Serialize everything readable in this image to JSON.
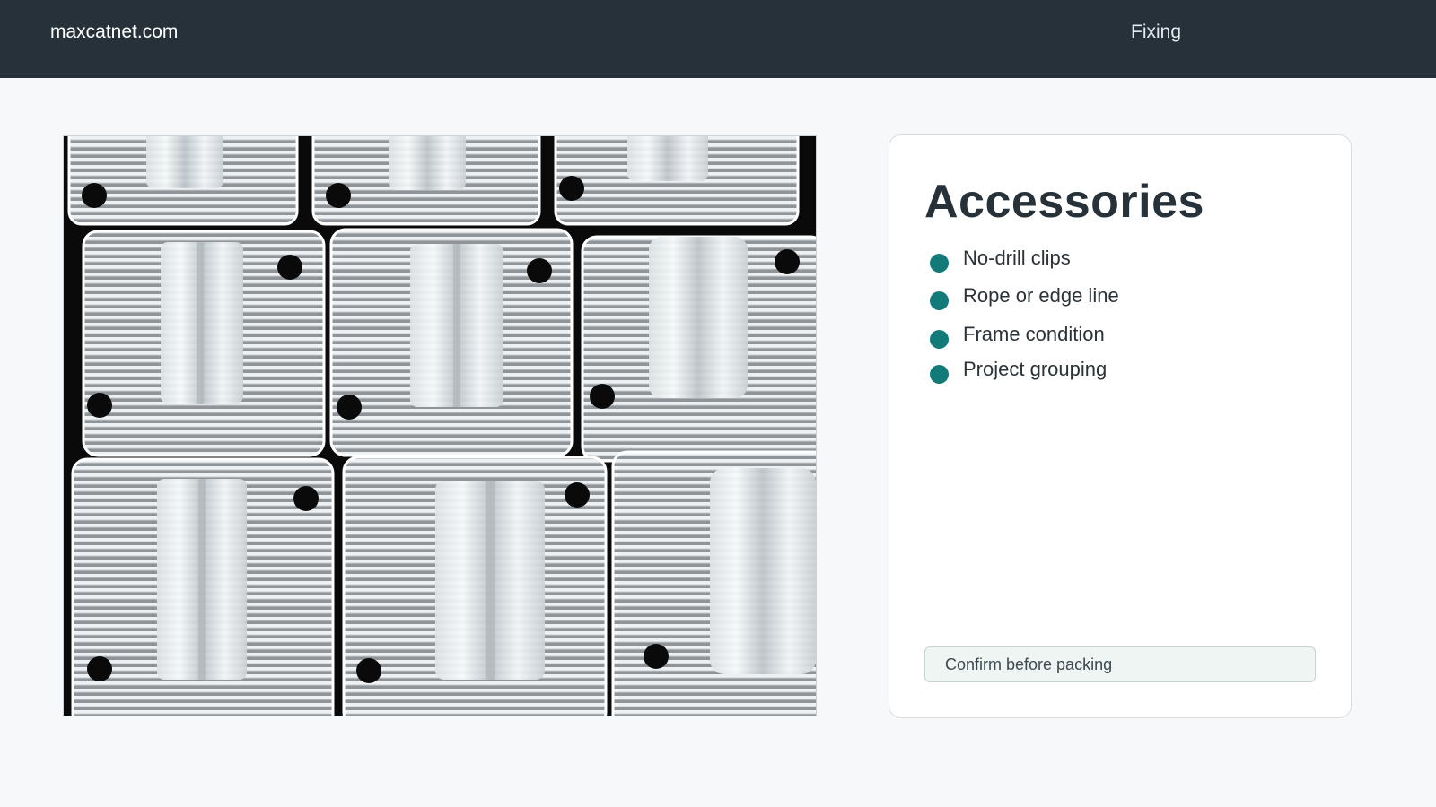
{
  "header": {
    "brand": "maxcatnet.com",
    "nav_link": "Fixing"
  },
  "photo": {
    "subject": "clear ribbed plastic no-drill clips",
    "icon": "product-photo"
  },
  "card": {
    "title": "Accessories",
    "items": [
      {
        "label": "No-drill clips"
      },
      {
        "label": "Rope or edge line"
      },
      {
        "label": "Frame condition"
      },
      {
        "label": "Project grouping"
      }
    ],
    "note": "Confirm before packing"
  },
  "colors": {
    "header_bg": "#263139",
    "page_bg": "#f6f8f9",
    "accent_teal": "#137a7a",
    "title_text": "#263139",
    "note_bg": "#eef5f3"
  }
}
